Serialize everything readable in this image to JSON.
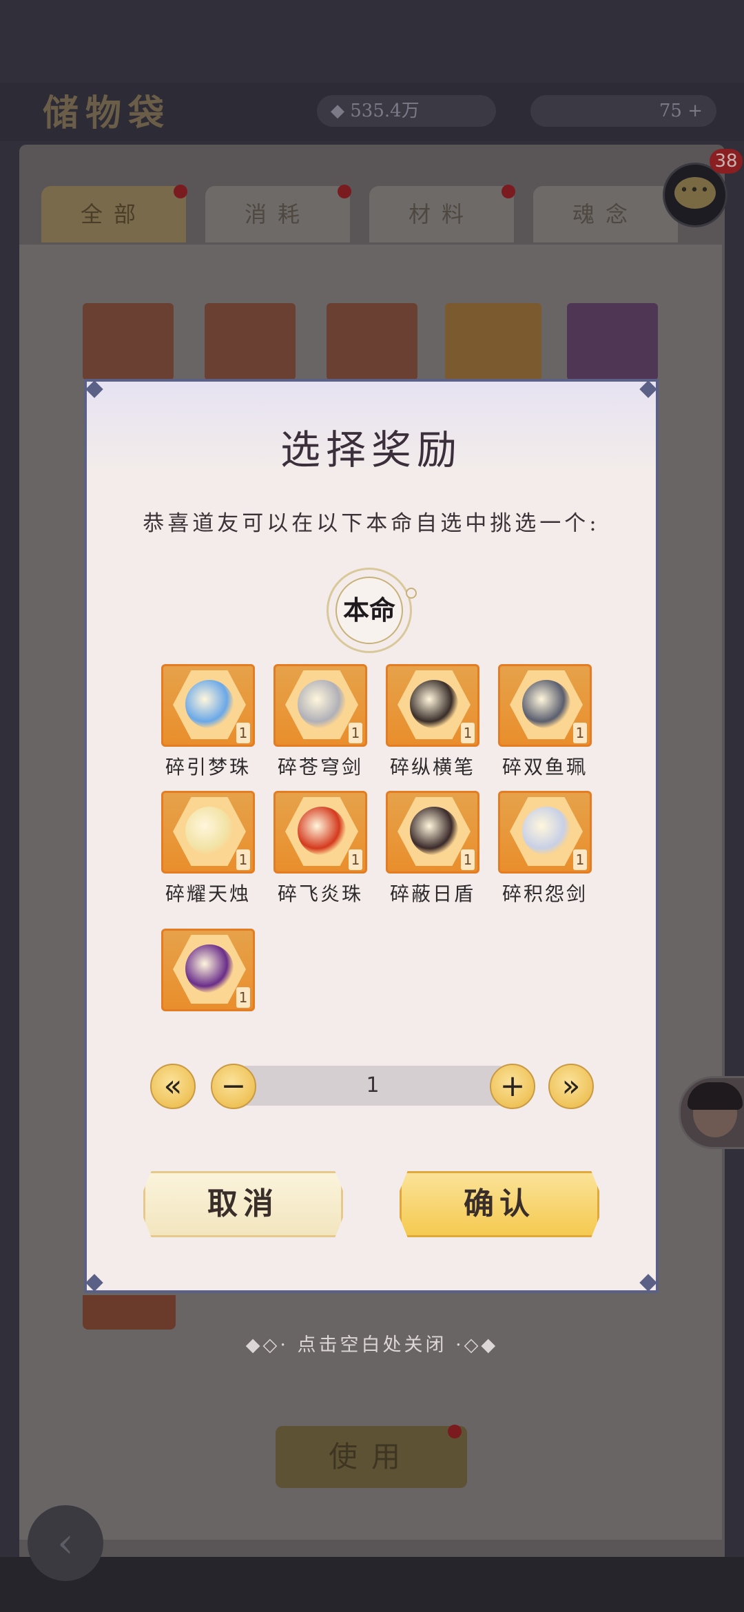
{
  "background": {
    "title": "储物袋",
    "resource1": "535.4万",
    "resource2": "75",
    "tabs": [
      "全部",
      "消耗",
      "材料",
      "魂念"
    ],
    "use_button": "使用",
    "chat_badge": "38"
  },
  "dialog": {
    "title": "选择奖励",
    "subtitle": "恭喜道友可以在以下本命自选中挑选一个:",
    "seal_label": "本命",
    "items": [
      {
        "name": "碎引梦珠",
        "count": "1",
        "color": "#6aa8e8"
      },
      {
        "name": "碎苍穹剑",
        "count": "1",
        "color": "#b0b0b8"
      },
      {
        "name": "碎纵横笔",
        "count": "1",
        "color": "#3a2e2a"
      },
      {
        "name": "碎双鱼珮",
        "count": "1",
        "color": "#5a5e6e"
      },
      {
        "name": "碎耀天烛",
        "count": "1",
        "color": "#f2e3a6"
      },
      {
        "name": "碎飞炎珠",
        "count": "1",
        "color": "#d43a1e"
      },
      {
        "name": "碎蔽日盾",
        "count": "1",
        "color": "#3a2a2a"
      },
      {
        "name": "碎积怨剑",
        "count": "1",
        "color": "#c8d0e6"
      },
      {
        "name": "",
        "count": "1",
        "color": "#6a2e8a"
      }
    ],
    "quantity": "1",
    "min_icon": "«",
    "minus_icon": "−",
    "plus_icon": "+",
    "max_icon": "»",
    "cancel_label": "取消",
    "confirm_label": "确认"
  },
  "close_hint": "◆◇· 点击空白处关闭 ·◇◆"
}
